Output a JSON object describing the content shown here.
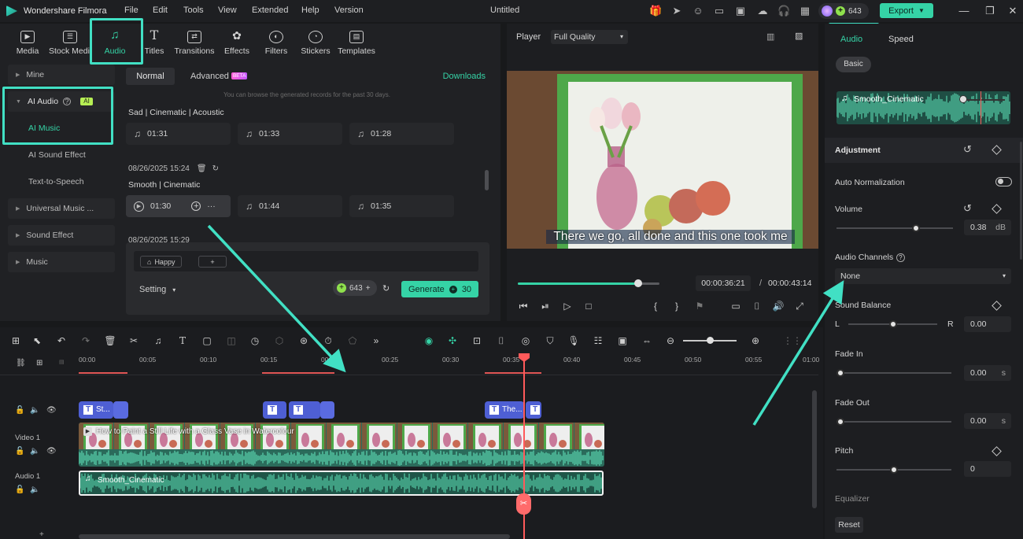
{
  "app": {
    "name": "Wondershare Filmora",
    "document_title": "Untitled"
  },
  "menu": [
    "File",
    "Edit",
    "Tools",
    "View",
    "Extended",
    "Help",
    "Version"
  ],
  "header": {
    "credits": "643",
    "export_label": "Export"
  },
  "media_tabs": [
    {
      "label": "Media",
      "icon": "media-icon"
    },
    {
      "label": "Stock Media",
      "icon": "stock-media-icon"
    },
    {
      "label": "Audio",
      "icon": "music-note-icon",
      "active": true
    },
    {
      "label": "Titles",
      "icon": "text-icon"
    },
    {
      "label": "Transitions",
      "icon": "transition-icon"
    },
    {
      "label": "Effects",
      "icon": "effects-icon"
    },
    {
      "label": "Filters",
      "icon": "filter-icon"
    },
    {
      "label": "Stickers",
      "icon": "sticker-icon"
    },
    {
      "label": "Templates",
      "icon": "template-icon"
    }
  ],
  "sidebar": {
    "mine": "Mine",
    "ai_audio": "AI Audio",
    "ai_badge": "AI",
    "ai_music": "AI Music",
    "ai_sound_effect": "AI Sound Effect",
    "text_to_speech": "Text-to-Speech",
    "universal_music": "Universal Music ...",
    "sound_effect": "Sound Effect",
    "music": "Music"
  },
  "audio_panel": {
    "tab_normal": "Normal",
    "tab_advanced": "Advanced",
    "beta": "BETA",
    "downloads": "Downloads",
    "hint": "You can browse the generated records for the past 30 days.",
    "group1_title": "Sad | Cinematic | Acoustic",
    "group1_tracks": [
      "01:31",
      "01:33",
      "01:28"
    ],
    "group2_date": "08/26/2025 15:24",
    "group2_title": "Smooth | Cinematic",
    "group2_tracks": [
      "01:30",
      "01:44",
      "01:35"
    ],
    "group3_date": "08/26/2025 15:29"
  },
  "generator": {
    "chip": "Happy",
    "setting": "Setting",
    "credits": "643",
    "generate_label": "Generate",
    "cost": "30"
  },
  "player": {
    "tab": "Player",
    "quality": "Full Quality",
    "subtitle": "There we go, all done and this one took me",
    "current_time": "00:00:36:21",
    "separator": "/",
    "total_time": "00:00:43:14",
    "progress": 0.85
  },
  "right_panel": {
    "tab_audio": "Audio",
    "tab_speed": "Speed",
    "sub_basic": "Basic",
    "clip_name": "Smooth_Cinematic",
    "adjustment": "Adjustment",
    "auto_normalization": "Auto Normalization",
    "volume": "Volume",
    "volume_value": "0.38",
    "volume_unit": "dB",
    "volume_level": 0.68,
    "audio_channels": "Audio Channels",
    "channel_value": "None",
    "sound_balance": "Sound Balance",
    "balance_left": "L",
    "balance_right": "R",
    "balance_value": "0.00",
    "balance_level": 0.5,
    "fade_in": "Fade In",
    "fade_in_value": "0.00",
    "fade_out": "Fade Out",
    "fade_out_value": "0.00",
    "seconds_unit": "s",
    "pitch": "Pitch",
    "pitch_value": "0",
    "pitch_level": 0.5,
    "equalizer": "Equalizer",
    "reset": "Reset"
  },
  "timeline": {
    "ruler": [
      "00:00",
      "00:05",
      "00:10",
      "00:15",
      "00:20",
      "00:25",
      "00:30",
      "00:35",
      "00:40",
      "00:45",
      "00:50",
      "00:55",
      "01:00"
    ],
    "title_clips": [
      "St...",
      "The..."
    ],
    "video_track": "Video 1",
    "video_clip": "How to Paint a Still Life with a Glass Vase in Watercolour",
    "audio_track": "Audio 1",
    "audio_clip": "Smooth_Cinematic"
  },
  "colors": {
    "accent": "#35d3a6",
    "highlight": "#41e0c4",
    "playhead": "#ff5a5a",
    "title_clip": "#4e5fd4"
  }
}
